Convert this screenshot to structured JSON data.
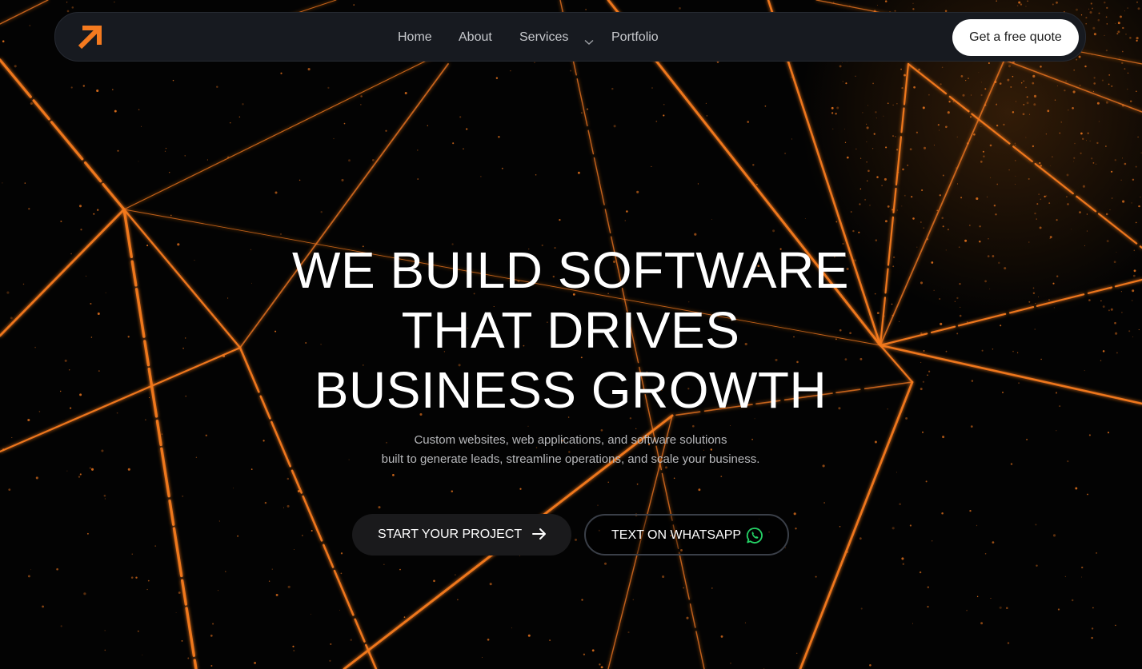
{
  "nav": {
    "logo_icon": "arrow-up-right-icon",
    "links": [
      "Home",
      "About",
      "Services",
      "Portfolio"
    ],
    "services_icon": "chevron-down-icon",
    "cta": "Get a free quote"
  },
  "hero": {
    "title_lines": [
      "WE BUILD SOFTWARE",
      "THAT DRIVES",
      "BUSINESS GROWTH"
    ],
    "subtitle_lines": [
      "Custom websites, web applications, and software solutions",
      "built to generate leads, streamline operations, and scale your business."
    ],
    "primary_button": "START YOUR PROJECT",
    "primary_icon": "arrow-right-icon",
    "secondary_button": "TEXT ON WHATSAPP",
    "secondary_icon": "whatsapp-icon"
  },
  "colors": {
    "accent": "#f47a1f",
    "background": "#030303",
    "nav_background": "#171a20",
    "whatsapp": "#25d366"
  }
}
